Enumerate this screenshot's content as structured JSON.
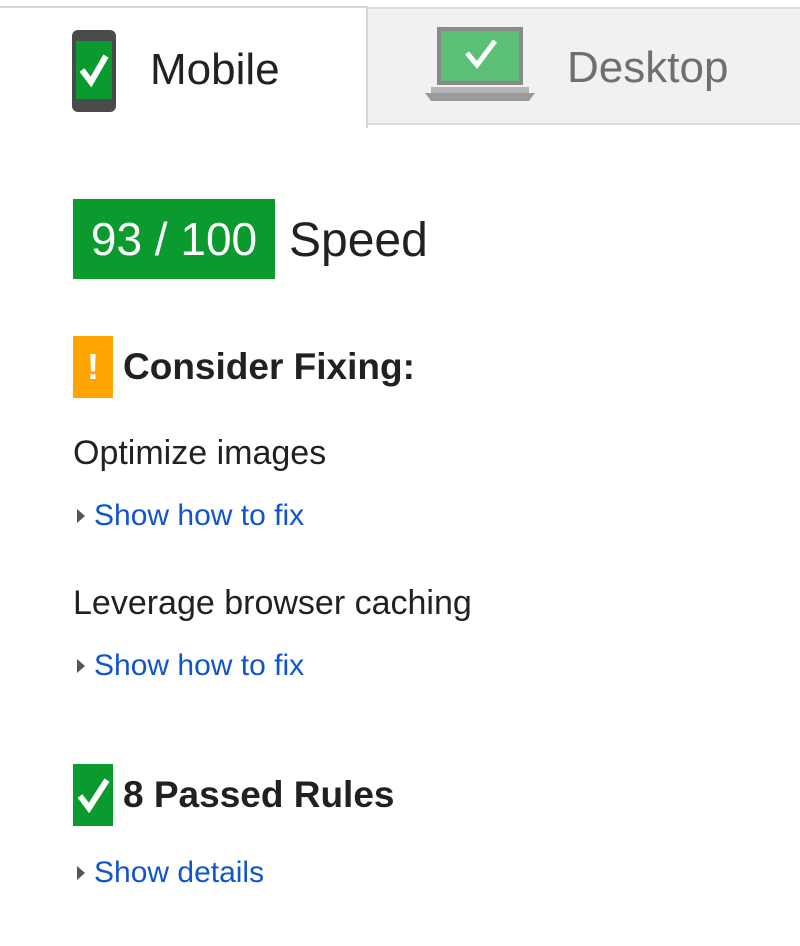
{
  "tabs": {
    "mobile": {
      "label": "Mobile",
      "icon": "mobile-check-icon",
      "selected": true
    },
    "desktop": {
      "label": "Desktop",
      "icon": "desktop-check-icon",
      "selected": false
    }
  },
  "score": {
    "text": "93 / 100",
    "value": 93,
    "max": 100,
    "label": "Speed"
  },
  "consider_fixing": {
    "icon_glyph": "!",
    "title": "Consider Fixing:",
    "rules": [
      {
        "title": "Optimize images",
        "link": "Show how to fix"
      },
      {
        "title": "Leverage browser caching",
        "link": "Show how to fix"
      }
    ]
  },
  "passed": {
    "title": "8 Passed Rules",
    "link": "Show details"
  },
  "colors": {
    "good": "#0a9a2e",
    "warning": "#ffa400",
    "link": "#1155cc",
    "text": "#212121",
    "muted_text": "#6f6f6f"
  }
}
